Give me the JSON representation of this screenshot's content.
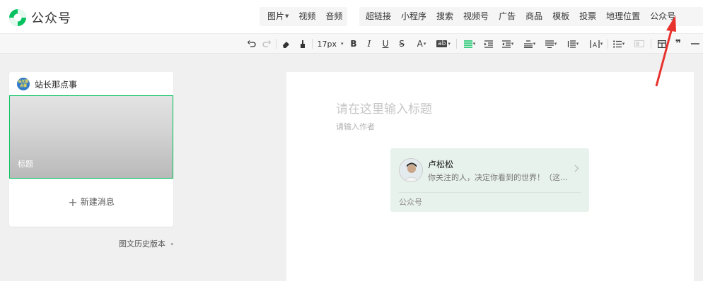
{
  "header": {
    "logo_text": "公众号",
    "media_items": [
      {
        "label": "图片",
        "caret": "▼"
      },
      {
        "label": "视频"
      },
      {
        "label": "音频"
      }
    ],
    "insert_items": [
      "超链接",
      "小程序",
      "搜索",
      "视频号",
      "广告",
      "商品",
      "模板",
      "投票",
      "地理位置",
      "公众号"
    ]
  },
  "format_toolbar": {
    "font_size": "17px",
    "bold": "B",
    "italic": "I",
    "underline": "U",
    "strike": "S",
    "font_color": "A",
    "bg_color": "ab",
    "quote": "❞",
    "caret": "▾"
  },
  "left_panel": {
    "account_name": "站长那点事",
    "avatar_text": "站长那点事",
    "cover_title": "标题",
    "new_message": "新建消息",
    "history": "图文历史版本"
  },
  "editor": {
    "title_placeholder": "请在这里输入标题",
    "author_placeholder": "请输入作者",
    "card": {
      "name": "卢松松",
      "desc": "你关注的人，决定你看到的世界！（这...",
      "tag": "公众号"
    }
  },
  "colors": {
    "accent": "#07c160",
    "arrow": "#e8322e"
  }
}
